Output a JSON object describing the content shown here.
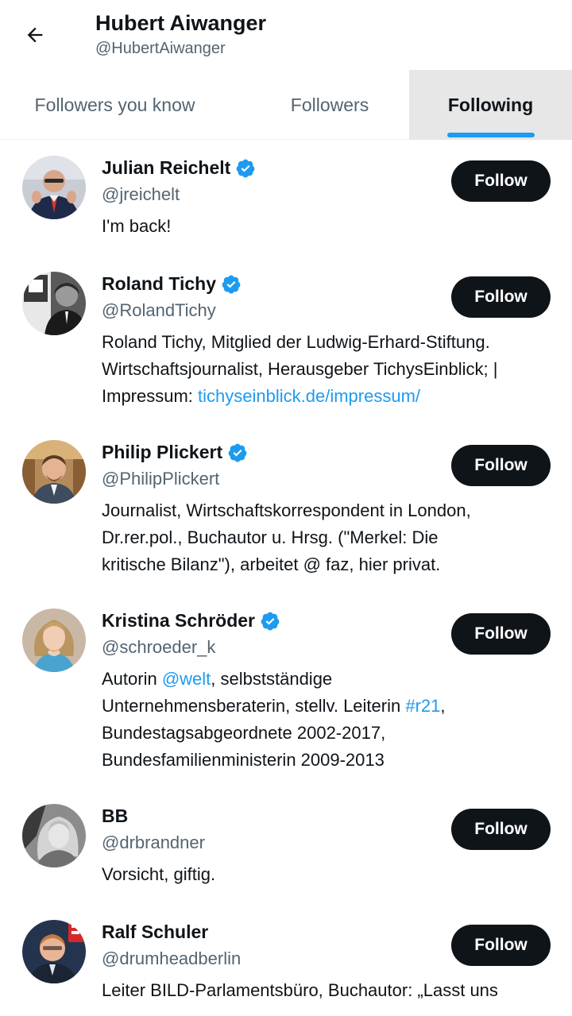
{
  "header": {
    "name": "Hubert Aiwanger",
    "handle": "@HubertAiwanger"
  },
  "tabs": [
    {
      "label": "Followers you know"
    },
    {
      "label": "Followers"
    },
    {
      "label": "Following"
    }
  ],
  "colors": {
    "accent": "#1d9bf0",
    "text": "#0f1419",
    "secondary": "#536471",
    "button": "#0f1419",
    "selected_tab_bg": "#e7e7e7"
  },
  "users": [
    {
      "name": "Julian Reichelt",
      "handle": "@jreichelt",
      "verified": true,
      "follow_label": "Follow",
      "bio": {
        "line1": "I'm back!"
      }
    },
    {
      "name": "Roland Tichy",
      "handle": "@RolandTichy",
      "verified": true,
      "follow_label": "Follow",
      "bio": {
        "line1": "Roland Tichy, Mitglied der Ludwig-Erhard-Stiftung.",
        "line2": "Wirtschaftsjournalist, Herausgeber TichysEinblick; |",
        "line3_prefix": "Impressum: ",
        "link": "tichyseinblick.de/impressum/"
      }
    },
    {
      "name": "Philip Plickert",
      "handle": "@PhilipPlickert",
      "verified": true,
      "follow_label": "Follow",
      "bio": {
        "line1": "Journalist, Wirtschaftskorrespondent in London,",
        "line2": "Dr.rer.pol., Buchautor u. Hrsg. (\"Merkel: Die",
        "line3": "kritische Bilanz\"), arbeitet @ faz, hier privat."
      }
    },
    {
      "name": "Kristina Schröder",
      "handle": "@schroeder_k",
      "verified": true,
      "follow_label": "Follow",
      "bio": {
        "line1_prefix": "Autorin ",
        "mention": "@welt",
        "line1_suffix": ", selbstständige",
        "line2_prefix": "Unternehmensberaterin, stellv. Leiterin ",
        "hashtag": "#r21",
        "line2_suffix": ",",
        "line3": "Bundestagsabgeordnete 2002-2017,",
        "line4": "Bundesfamilienministerin 2009-2013"
      }
    },
    {
      "name": "BB",
      "handle": "@drbrandner",
      "verified": false,
      "follow_label": "Follow",
      "bio": {
        "line1": "Vorsicht, giftig."
      }
    },
    {
      "name": "Ralf Schuler",
      "handle": "@drumheadberlin",
      "verified": false,
      "follow_label": "Follow",
      "bio": {
        "line1": "Leiter BILD-Parlamentsbüro, Buchautor: „Lasst uns"
      }
    }
  ]
}
